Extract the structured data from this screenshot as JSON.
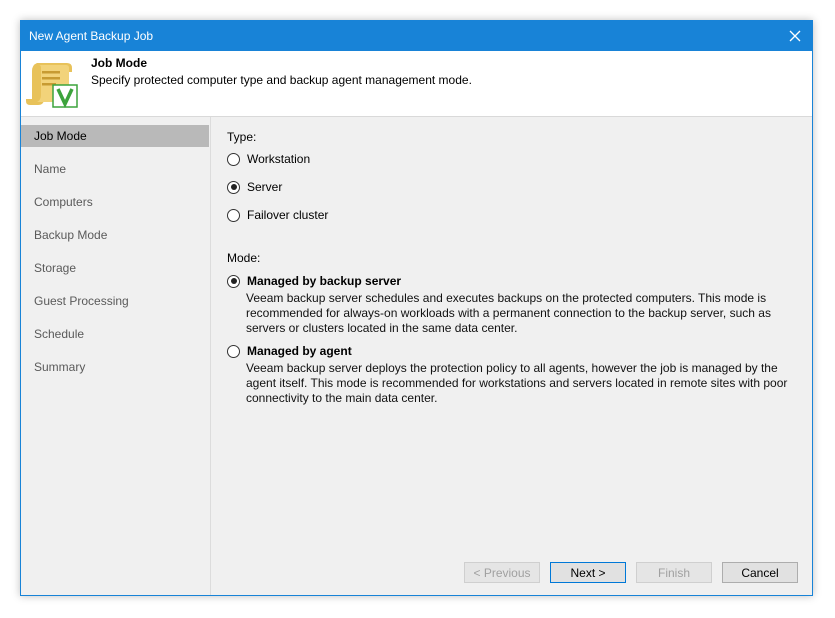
{
  "window": {
    "title": "New Agent Backup Job"
  },
  "header": {
    "title": "Job Mode",
    "subtitle": "Specify protected computer type and backup agent management mode."
  },
  "sidebar": {
    "items": [
      {
        "label": "Job Mode",
        "active": true
      },
      {
        "label": "Name"
      },
      {
        "label": "Computers"
      },
      {
        "label": "Backup Mode"
      },
      {
        "label": "Storage"
      },
      {
        "label": "Guest Processing"
      },
      {
        "label": "Schedule"
      },
      {
        "label": "Summary"
      }
    ]
  },
  "type_section": {
    "label": "Type:",
    "options": [
      {
        "label": "Workstation",
        "checked": false
      },
      {
        "label": "Server",
        "checked": true
      },
      {
        "label": "Failover cluster",
        "checked": false
      }
    ]
  },
  "mode_section": {
    "label": "Mode:",
    "options": [
      {
        "label": "Managed by backup server",
        "checked": true,
        "description": "Veeam backup server schedules and executes backups on the protected computers. This mode is recommended for always-on workloads with a permanent connection to the backup server, such as servers or clusters located in the same data center."
      },
      {
        "label": "Managed by agent",
        "checked": false,
        "description": "Veeam backup server deploys the protection policy to all agents, however the job is managed by the agent itself. This mode is recommended for workstations and servers located in remote sites with poor connectivity to the main data center."
      }
    ]
  },
  "buttons": {
    "previous": "< Previous",
    "next": "Next >",
    "finish": "Finish",
    "cancel": "Cancel"
  },
  "colors": {
    "titlebar": "#1883d7",
    "accent": "#0078d7"
  },
  "icons": {
    "close": "close-icon",
    "header": "scroll-checkmark-icon"
  }
}
